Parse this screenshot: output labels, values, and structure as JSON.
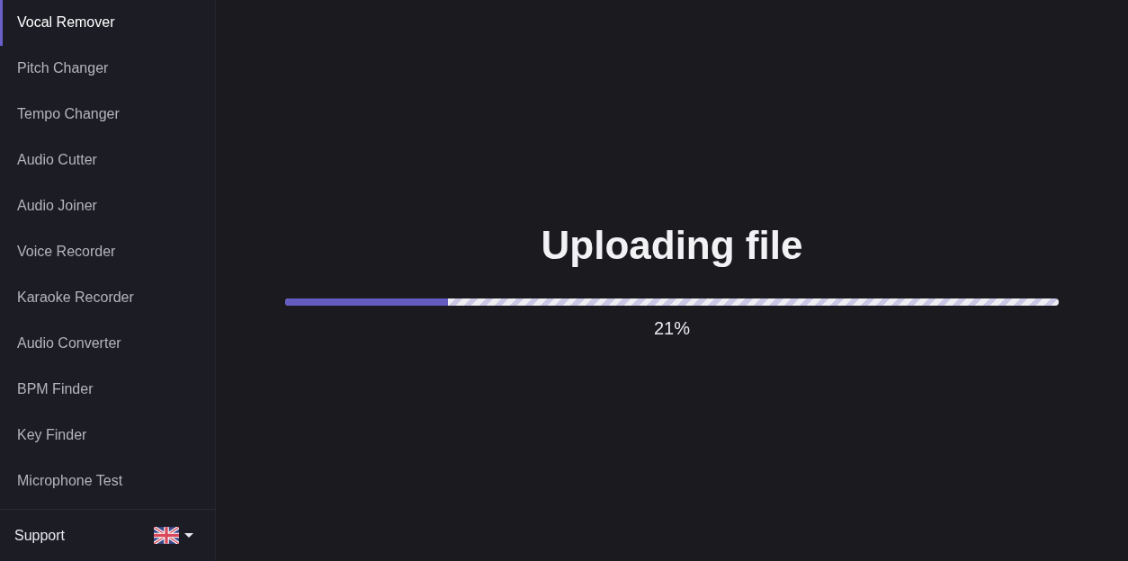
{
  "sidebar": {
    "items": [
      {
        "label": "Vocal Remover",
        "selected": true
      },
      {
        "label": "Pitch Changer",
        "selected": false
      },
      {
        "label": "Tempo Changer",
        "selected": false
      },
      {
        "label": "Audio Cutter",
        "selected": false
      },
      {
        "label": "Audio Joiner",
        "selected": false
      },
      {
        "label": "Voice Recorder",
        "selected": false
      },
      {
        "label": "Karaoke Recorder",
        "selected": false
      },
      {
        "label": "Audio Converter",
        "selected": false
      },
      {
        "label": "BPM Finder",
        "selected": false
      },
      {
        "label": "Key Finder",
        "selected": false
      },
      {
        "label": "Microphone Test",
        "selected": false
      }
    ],
    "footer": {
      "link": "Support"
    }
  },
  "upload": {
    "title": "Uploading file",
    "level": 0.21,
    "percent": "21%"
  }
}
